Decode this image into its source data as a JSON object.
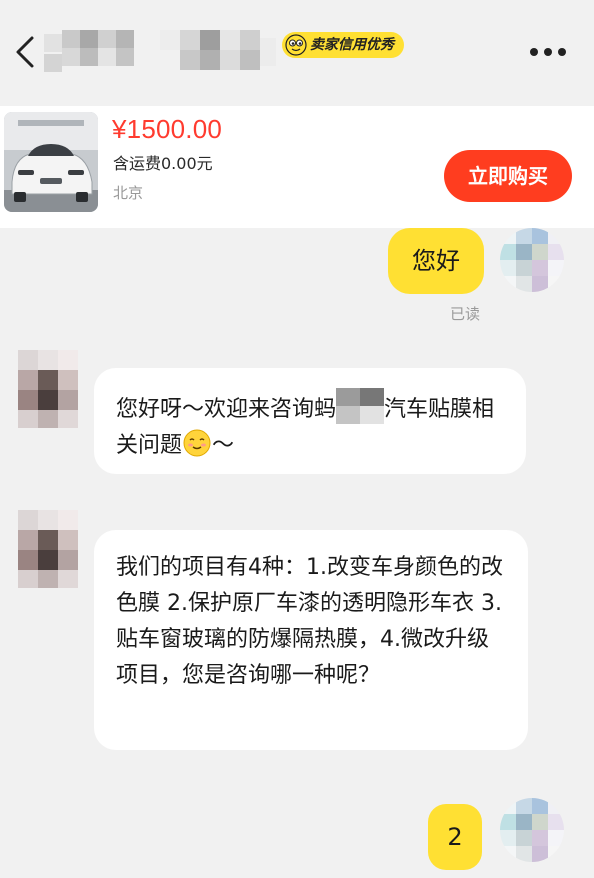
{
  "header": {
    "credit_badge": "卖家信用优秀",
    "icons": {
      "back": "chevron-left-icon",
      "more": "more-dots-icon",
      "badge": "fish-face-icon"
    }
  },
  "product": {
    "price": "¥1500.00",
    "shipping": "含运费0.00元",
    "location": "北京",
    "buy_label": "立即购买",
    "colors": {
      "price": "#ff3b2f",
      "buy_button": "#ff3d1f"
    }
  },
  "messages": [
    {
      "from": "me",
      "text": "您好",
      "status": "已读"
    },
    {
      "from": "seller",
      "text_before_censor": "您好呀～欢迎来咨询蚂",
      "text_after_censor": "汽车贴膜相关问题",
      "text_tail": "～"
    },
    {
      "from": "seller",
      "text": "我们的项目有4种：1.改变车身颜色的改色膜 2.保护原厂车漆的透明隐形车衣 3.贴车窗玻璃的防爆隔热膜，4.微改升级项目，您是咨询哪一种呢？"
    },
    {
      "from": "me",
      "text": "2"
    }
  ],
  "theme": {
    "accent_yellow": "#ffe033",
    "background": "#f1f1f1"
  }
}
